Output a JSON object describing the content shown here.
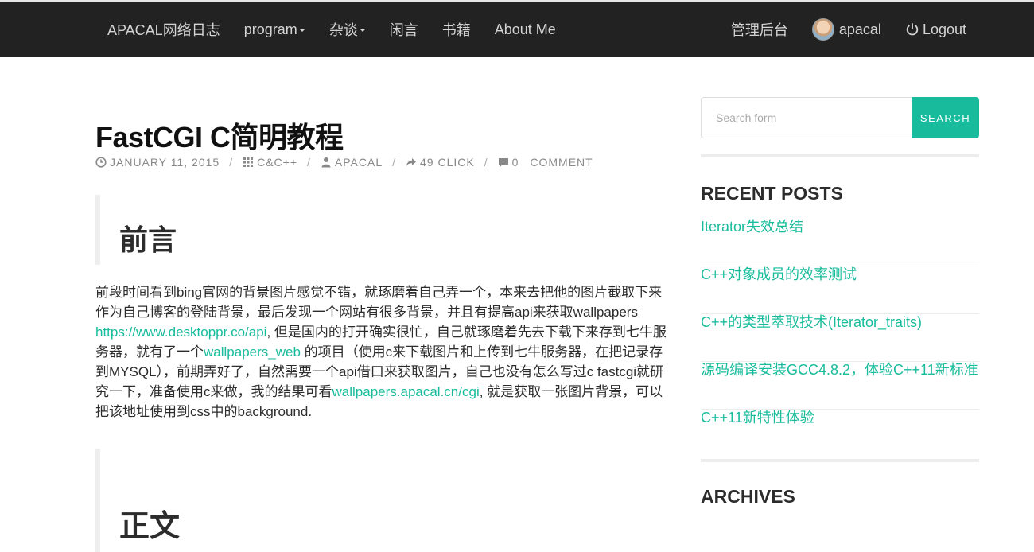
{
  "nav": {
    "brand": "APACAL网络日志",
    "items": [
      {
        "label": "program",
        "dropdown": true
      },
      {
        "label": "杂谈",
        "dropdown": true
      },
      {
        "label": "闲言",
        "dropdown": false
      },
      {
        "label": "书籍",
        "dropdown": false
      },
      {
        "label": "About Me",
        "dropdown": false
      }
    ],
    "admin": "管理后台",
    "user": "apacal",
    "logout": "Logout"
  },
  "post": {
    "title": "FastCGI C简明教程",
    "meta": {
      "date": "JANUARY 11, 2015",
      "category": "C&C++",
      "author": "APACAL",
      "clicks": "49 CLICK",
      "comment_count": "0",
      "comment_label": "COMMENT",
      "separator": "/"
    },
    "heading1": "前言",
    "paragraph": {
      "t1": "前段时间看到bing官网的背景图片感觉不错，就琢磨着自己弄一个，本来去把他的图片截取下来作为自己博客的登陆背景，最后发现一个网站有很多背景，并且有提高api来获取wallpapers ",
      "link1": "https://www.desktoppr.co/api",
      "t2": ", 但是国内的打开确实很忙，自己就琢磨着先去下载下来存到七牛服务器，就有了一个",
      "link2": "wallpapers_web",
      "t3": " 的项目（使用c来下载图片和上传到七牛服务器，在把记录存到MYSQL），前期弄好了，自然需要一个api借口来获取图片，自己也没有怎么写过c fastcgi就研究一下，准备使用c来做，我的结果可看",
      "link3": "wallpapers.apacal.cn/cgi",
      "t4": ", 就是获取一张图片背景，可以把该地址使用到css中的background."
    },
    "heading2": "正文"
  },
  "sidebar": {
    "search_placeholder": "Search form",
    "search_button": "SEARCH",
    "recent_title": "RECENT POSTS",
    "recent_posts": [
      "Iterator失效总结",
      "C++对象成员的效率测试",
      "C++的类型萃取技术(Iterator_traits)",
      "源码编译安装GCC4.8.2，体验C++11新标准",
      "C++11新特性体验"
    ],
    "archives_title": "ARCHIVES"
  },
  "colors": {
    "accent": "#18bc9c",
    "navbar": "#222222"
  }
}
